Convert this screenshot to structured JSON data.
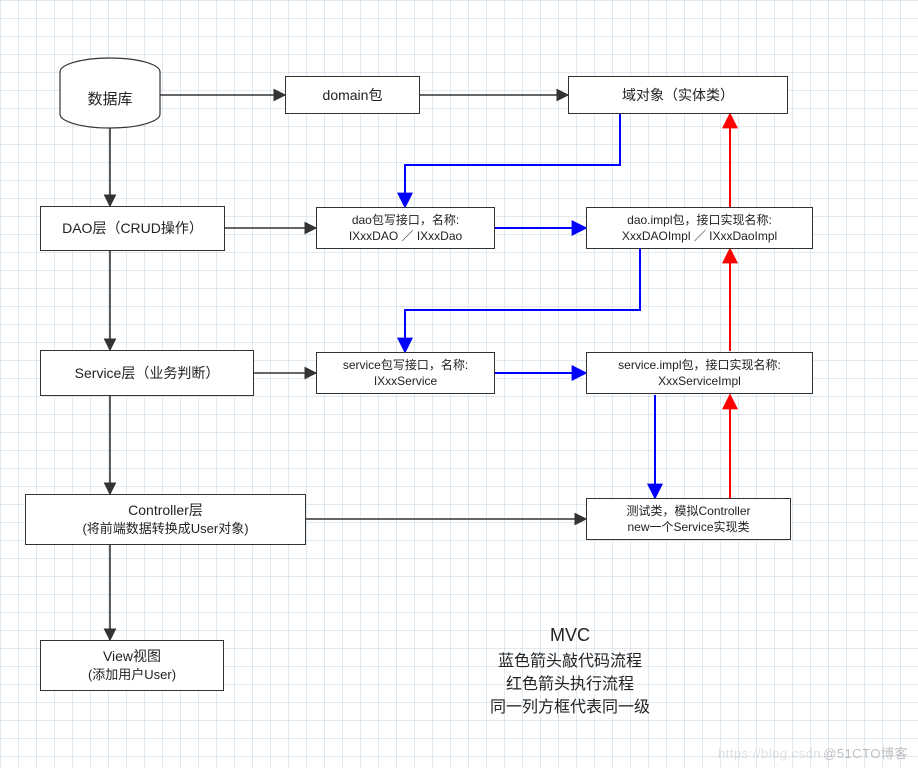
{
  "nodes": {
    "db": "数据库",
    "domain": "domain包",
    "entity": "域对象（实体类）",
    "dao_layer": "DAO层（CRUD操作）",
    "dao_if_l1": "dao包写接口，名称:",
    "dao_if_l2": "IXxxDAO ／ IXxxDao",
    "dao_impl_l1": "dao.impl包，接口实现名称:",
    "dao_impl_l2": "XxxDAOImpl ／ IXxxDaoImpl",
    "service_layer": "Service层（业务判断）",
    "service_if_l1": "service包写接口，名称:",
    "service_if_l2": "IXxxService",
    "service_impl_l1": "service.impl包，接口实现名称:",
    "service_impl_l2": "XxxServiceImpl",
    "controller_l1": "Controller层",
    "controller_l2": "(将前端数据转换成User对象)",
    "test_l1": "测试类，模拟Controller",
    "test_l2": "new一个Service实现类",
    "view_l1": "View视图",
    "view_l2": "(添加用户User)"
  },
  "legend": {
    "title": "MVC",
    "blue": "蓝色箭头敲代码流程",
    "red": "红色箭头执行流程",
    "same": "同一列方框代表同一级"
  },
  "watermark": {
    "faint": "https://blog.csdn",
    "text": "@51CTO博客"
  },
  "colors": {
    "black": "#333333",
    "blue": "#0000ff",
    "red": "#ff0000"
  },
  "chart_data": {
    "type": "diagram",
    "title": "MVC",
    "nodes": [
      {
        "id": "db",
        "label": "数据库",
        "kind": "cylinder"
      },
      {
        "id": "domain",
        "label": "domain包",
        "kind": "rect"
      },
      {
        "id": "entity",
        "label": "域对象（实体类）",
        "kind": "rect"
      },
      {
        "id": "dao_layer",
        "label": "DAO层（CRUD操作）",
        "kind": "rect"
      },
      {
        "id": "dao_if",
        "label": "dao包写接口，名称: IXxxDAO ／ IXxxDao",
        "kind": "rect"
      },
      {
        "id": "dao_impl",
        "label": "dao.impl包，接口实现名称: XxxDAOImpl ／ IXxxDaoImpl",
        "kind": "rect"
      },
      {
        "id": "service_layer",
        "label": "Service层（业务判断）",
        "kind": "rect"
      },
      {
        "id": "service_if",
        "label": "service包写接口，名称: IXxxService",
        "kind": "rect"
      },
      {
        "id": "service_impl",
        "label": "service.impl包，接口实现名称: XxxServiceImpl",
        "kind": "rect"
      },
      {
        "id": "controller",
        "label": "Controller层 (将前端数据转换成User对象)",
        "kind": "rect"
      },
      {
        "id": "test",
        "label": "测试类，模拟Controller new一个Service实现类",
        "kind": "rect"
      },
      {
        "id": "view",
        "label": "View视图 (添加用户User)",
        "kind": "rect"
      }
    ],
    "edges": [
      {
        "from": "db",
        "to": "domain",
        "color": "black"
      },
      {
        "from": "domain",
        "to": "entity",
        "color": "black"
      },
      {
        "from": "db",
        "to": "dao_layer",
        "color": "black"
      },
      {
        "from": "dao_layer",
        "to": "dao_if",
        "color": "black"
      },
      {
        "from": "dao_layer",
        "to": "service_layer",
        "color": "black"
      },
      {
        "from": "service_layer",
        "to": "service_if",
        "color": "black"
      },
      {
        "from": "service_layer",
        "to": "controller",
        "color": "black"
      },
      {
        "from": "controller",
        "to": "test",
        "color": "black"
      },
      {
        "from": "controller",
        "to": "view",
        "color": "black"
      },
      {
        "from": "entity",
        "to": "dao_if",
        "color": "blue",
        "note": "via corner"
      },
      {
        "from": "dao_if",
        "to": "dao_impl",
        "color": "blue"
      },
      {
        "from": "dao_if",
        "to": "service_if",
        "color": "blue",
        "note": "via corner"
      },
      {
        "from": "service_if",
        "to": "service_impl",
        "color": "blue"
      },
      {
        "from": "service_impl",
        "to": "test",
        "color": "blue"
      },
      {
        "from": "test",
        "to": "service_impl",
        "color": "red"
      },
      {
        "from": "service_impl",
        "to": "dao_impl",
        "color": "red"
      },
      {
        "from": "dao_impl",
        "to": "entity",
        "color": "red"
      }
    ],
    "legend": {
      "blue": "蓝色箭头敲代码流程",
      "red": "红色箭头执行流程",
      "note": "同一列方框代表同一级"
    }
  }
}
